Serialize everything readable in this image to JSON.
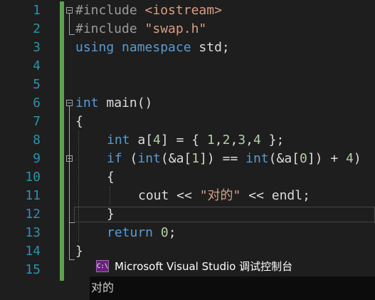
{
  "editor": {
    "line_numbers": [
      "1",
      "2",
      "3",
      "4",
      "5",
      "6",
      "7",
      "8",
      "9",
      "10",
      "11",
      "12",
      "13",
      "14",
      "15"
    ],
    "lines": {
      "l1": {
        "pre": "#include",
        "file": "<iostream>"
      },
      "l2": {
        "pre": "#include",
        "file": "\"swap.h\""
      },
      "l3": {
        "kw1": "using",
        "kw2": "namespace",
        "rest": "std;"
      },
      "l6": {
        "kw": "int",
        "rest": "main()"
      },
      "l7": {
        "text": "{"
      },
      "l8": {
        "kw": "int",
        "a": "a[",
        "n4": "4",
        "b": "] = { ",
        "n1": "1",
        "c1": ",",
        "n2": "2",
        "c2": ",",
        "n3": "3",
        "c3": ",",
        "n5": "4",
        "end": " };"
      },
      "l9": {
        "kw": "if",
        "a": " (",
        "kw2": "int",
        "b": "(&a[",
        "n1": "1",
        "c": "]) == ",
        "kw3": "int",
        "d": "(&a[",
        "n0": "0",
        "e": "]) + ",
        "n4": "4",
        "f": ")"
      },
      "l10": {
        "text": "{"
      },
      "l11": {
        "a": "cout << ",
        "str": "\"对的\"",
        "b": " << endl;"
      },
      "l12": {
        "text": "}"
      },
      "l13": {
        "kw": "return",
        "a": " ",
        "n0": "0",
        "b": ";"
      },
      "l14": {
        "text": "}"
      }
    }
  },
  "console": {
    "icon_text": "C:\\",
    "title": "Microsoft Visual Studio 调试控制台",
    "output": "对的"
  },
  "colors": {
    "keyword": "#569cd6",
    "string": "#d69d85",
    "preprocessor": "#9b9b9b",
    "line_number": "#2b91af",
    "change_bar": "#57a64a"
  }
}
